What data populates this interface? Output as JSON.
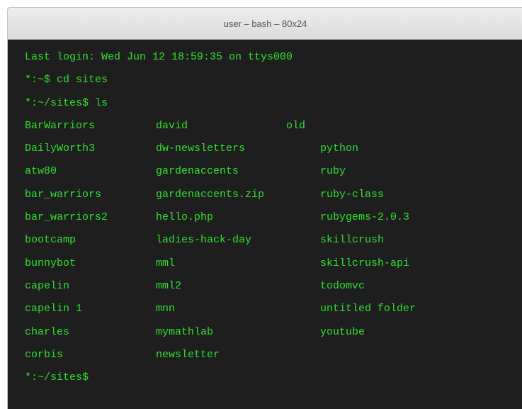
{
  "window": {
    "title": "user – bash – 80x24",
    "colors": {
      "background": "#1e1e1e",
      "text": "#2fe02f",
      "titlebar": "#e4e4e4"
    }
  },
  "terminal": {
    "login_line": "Last login: Wed Jun 12 18:59:35 on ttys000",
    "commands": [
      "*:~$ cd sites",
      "*:~/sites$ ls"
    ],
    "ls_rows": [
      [
        "BarWarriors",
        "david",
        "old"
      ],
      [
        "DailyWorth3",
        "dw-newsletters",
        "python"
      ],
      [
        "atw80",
        "gardenaccents",
        "ruby"
      ],
      [
        "bar_warriors",
        "gardenaccents.zip",
        "ruby-class"
      ],
      [
        "bar_warriors2",
        "hello.php",
        "rubygems-2.0.3"
      ],
      [
        "bootcamp",
        "ladies-hack-day",
        "skillcrush"
      ],
      [
        "bunnybot",
        "mml",
        "skillcrush-api"
      ],
      [
        "capelin",
        "mml2",
        "todomvc"
      ],
      [
        "capelin 1",
        "mnn",
        "untitled folder"
      ],
      [
        "charles",
        "mymathlab",
        "youtube"
      ],
      [
        "corbis",
        "newsletter",
        ""
      ]
    ],
    "prompt": "*:~/sites$"
  }
}
